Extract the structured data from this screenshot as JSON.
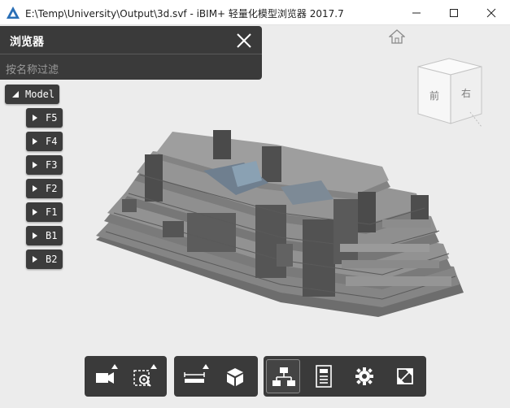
{
  "window": {
    "title": "E:\\Temp\\University\\Output\\3d.svf - iBIM+ 轻量化模型浏览器 2017.7",
    "controls": [
      "minimize",
      "maximize",
      "close"
    ]
  },
  "browser_panel": {
    "title": "浏览器",
    "filter_placeholder": "按名称过滤",
    "tree": {
      "root": "Model",
      "levels": [
        "F5",
        "F4",
        "F3",
        "F2",
        "F1",
        "B1",
        "B2"
      ]
    }
  },
  "viewcube": {
    "front_label": "前",
    "right_label": "右"
  },
  "toolbar": {
    "groups": [
      [
        "camera-icon",
        "zoom-window-icon"
      ],
      [
        "measure-icon",
        "section-box-icon"
      ],
      [
        "model-tree-icon",
        "properties-icon",
        "settings-icon",
        "fullscreen-icon"
      ]
    ],
    "active": "model-tree-icon"
  },
  "colors": {
    "panel_bg": "#3a3a3a",
    "viewport_bg": "#ececec",
    "app_icon": "#2a6fb6"
  }
}
